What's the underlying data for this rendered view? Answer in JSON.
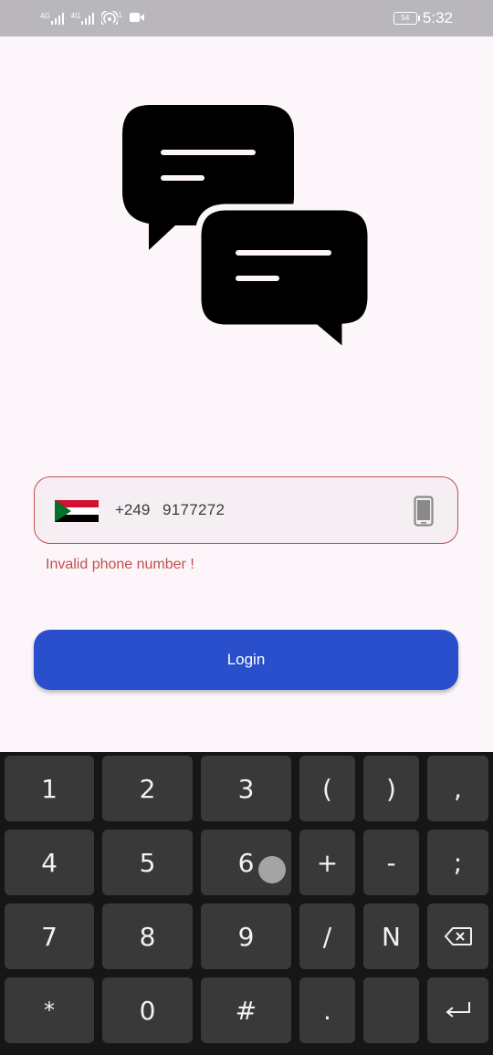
{
  "status_bar": {
    "signal_1_label": "4G",
    "signal_2_label": "4G",
    "hotspot_label": "1",
    "battery_level": "54",
    "time": "5:32"
  },
  "phone_field": {
    "country_flag": "sudan-flag",
    "dial_code": "+249",
    "value": "9177272",
    "icon": "mobile-phone-icon"
  },
  "error_message": "Invalid phone number !",
  "login_label": "Login",
  "keyboard": {
    "rows": [
      [
        "1",
        "2",
        "3",
        "(",
        ")",
        ","
      ],
      [
        "4",
        "5",
        "6",
        "+",
        "-",
        ";"
      ],
      [
        "7",
        "8",
        "9",
        "/",
        "N",
        "backspace"
      ],
      [
        "*",
        "0",
        "#",
        ".",
        "",
        "enter"
      ]
    ]
  },
  "colors": {
    "background": "#fcf6fb",
    "error": "#c0504a",
    "login_button": "#2a4fcc",
    "keyboard_bg": "#161616",
    "key_bg": "#393939"
  }
}
